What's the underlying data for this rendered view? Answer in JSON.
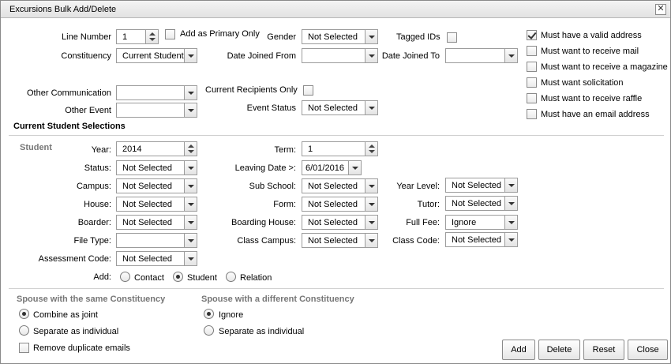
{
  "window": {
    "title": "Excursions Bulk Add/Delete"
  },
  "top": {
    "line_number": {
      "label": "Line Number",
      "value": "1"
    },
    "primary_only": {
      "label": "Add as Primary Only",
      "checked": false
    },
    "gender": {
      "label": "Gender",
      "value": "Not Selected"
    },
    "tagged_ids": {
      "label": "Tagged IDs",
      "checked": false
    },
    "constituency": {
      "label": "Constituency",
      "value": "Current Student"
    },
    "date_joined_from": {
      "label": "Date Joined From",
      "value": ""
    },
    "date_joined_to": {
      "label": "Date Joined To",
      "value": ""
    },
    "other_communication": {
      "label": "Other Communication",
      "value": ""
    },
    "current_recipients": {
      "label": "Current Recipients Only",
      "checked": false
    },
    "other_event": {
      "label": "Other Event",
      "value": ""
    },
    "event_status": {
      "label": "Event Status",
      "value": "Not Selected"
    }
  },
  "musts": [
    {
      "label": "Must have a valid address",
      "checked": true
    },
    {
      "label": "Must want to receive mail",
      "checked": false
    },
    {
      "label": "Must want to receive a magazine",
      "checked": false
    },
    {
      "label": "Must want solicitation",
      "checked": false
    },
    {
      "label": "Must want to receive raffle",
      "checked": false
    },
    {
      "label": "Must have an email address",
      "checked": false
    }
  ],
  "selections": {
    "heading": "Current Student Selections",
    "group_label": "Student",
    "year": {
      "label": "Year:",
      "value": "2014"
    },
    "term": {
      "label": "Term:",
      "value": "1"
    },
    "status": {
      "label": "Status:",
      "value": "Not Selected"
    },
    "leaving_date": {
      "label": "Leaving Date >:",
      "value": "6/01/2016"
    },
    "campus": {
      "label": "Campus:",
      "value": "Not Selected"
    },
    "sub_school": {
      "label": "Sub School:",
      "value": "Not Selected"
    },
    "year_level": {
      "label": "Year Level:",
      "value": "Not Selected"
    },
    "house": {
      "label": "House:",
      "value": "Not Selected"
    },
    "form": {
      "label": "Form:",
      "value": "Not Selected"
    },
    "tutor": {
      "label": "Tutor:",
      "value": "Not Selected"
    },
    "boarder": {
      "label": "Boarder:",
      "value": "Not Selected"
    },
    "boarding_house": {
      "label": "Boarding House:",
      "value": "Not Selected"
    },
    "full_fee": {
      "label": "Full Fee:",
      "value": "Ignore"
    },
    "file_type": {
      "label": "File Type:",
      "value": ""
    },
    "class_campus": {
      "label": "Class Campus:",
      "value": "Not Selected"
    },
    "class_code": {
      "label": "Class Code:",
      "value": "Not Selected"
    },
    "assessment_code": {
      "label": "Assessment Code:",
      "value": "Not Selected"
    },
    "add": {
      "label": "Add:",
      "options": [
        "Contact",
        "Student",
        "Relation"
      ],
      "selected": "Student"
    }
  },
  "spouse_same": {
    "heading": "Spouse with the same Constituency",
    "options": [
      "Combine as joint",
      "Separate as individual"
    ],
    "selected": "Combine as joint",
    "remove_dup": {
      "label": "Remove duplicate emails",
      "checked": false
    }
  },
  "spouse_diff": {
    "heading": "Spouse with a different Constituency",
    "options": [
      "Ignore",
      "Separate as individual"
    ],
    "selected": "Ignore"
  },
  "buttons": {
    "add": "Add",
    "delete": "Delete",
    "reset": "Reset",
    "close": "Close"
  }
}
